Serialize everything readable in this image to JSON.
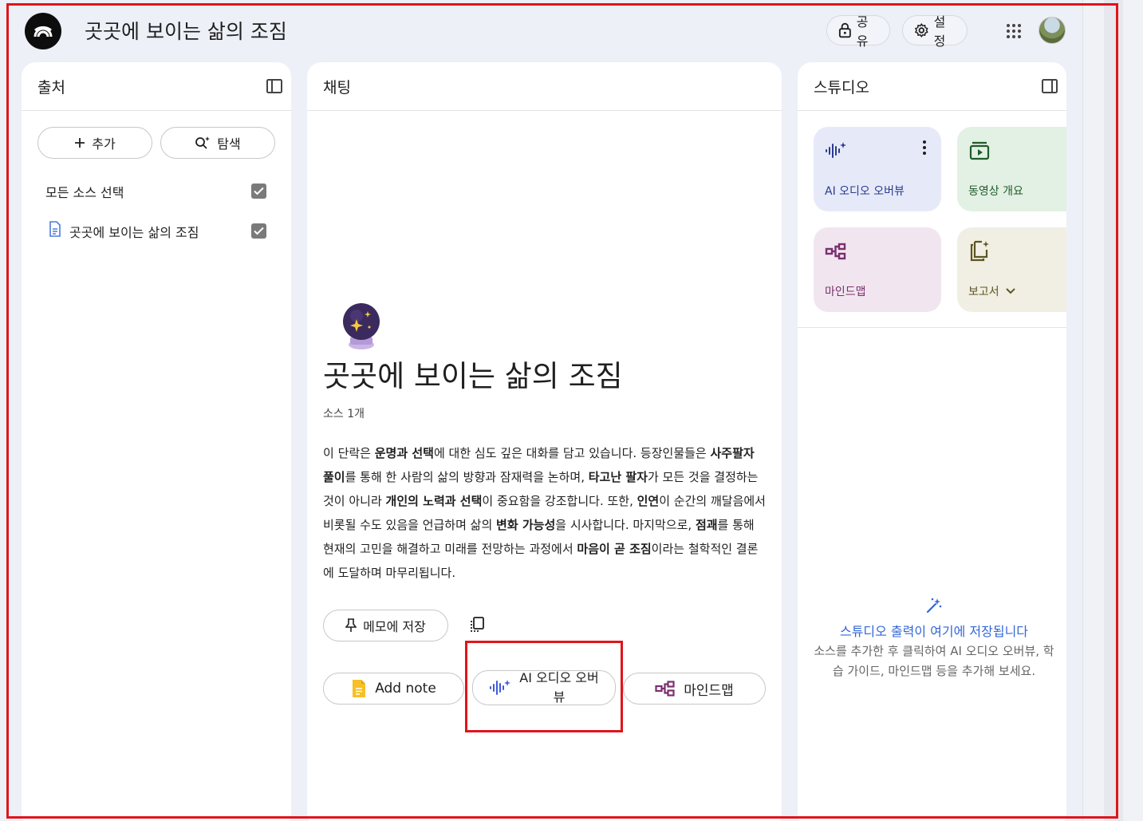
{
  "header": {
    "title": "곳곳에 보이는 삶의 조짐",
    "share_label": "공유",
    "settings_label": "설정"
  },
  "sources": {
    "title": "출처",
    "add_label": "추가",
    "explore_label": "탐색",
    "select_all_label": "모든 소스 선택",
    "items": [
      {
        "label": "곳곳에 보이는 삶의 조짐",
        "checked": true
      }
    ]
  },
  "chat": {
    "title": "채팅",
    "notebook_title": "곳곳에 보이는 삶의 조짐",
    "source_count": "소스 1개",
    "summary_parts": [
      {
        "text": "이 단락은 ",
        "bold": false
      },
      {
        "text": "운명과 선택",
        "bold": true
      },
      {
        "text": "에 대한 심도 깊은 대화를 담고 있습니다. 등장인물들은 ",
        "bold": false
      },
      {
        "text": "사주팔자 풀이",
        "bold": true
      },
      {
        "text": "를 통해 한 사람의 삶의 방향과 잠재력을 논하며, ",
        "bold": false
      },
      {
        "text": "타고난 팔자",
        "bold": true
      },
      {
        "text": "가 모든 것을 결정하는 것이 아니라 ",
        "bold": false
      },
      {
        "text": "개인의 노력과 선택",
        "bold": true
      },
      {
        "text": "이 중요함을 강조합니다. 또한, ",
        "bold": false
      },
      {
        "text": "인연",
        "bold": true
      },
      {
        "text": "이 순간의 깨달음에서 비롯될 수도 있음을 언급하며 삶의 ",
        "bold": false
      },
      {
        "text": "변화 가능성",
        "bold": true
      },
      {
        "text": "을 시사합니다. 마지막으로, ",
        "bold": false
      },
      {
        "text": "점괘",
        "bold": true
      },
      {
        "text": "를 통해 현재의 고민을 해결하고 미래를 전망하는 과정에서 ",
        "bold": false
      },
      {
        "text": "마음이 곧 조짐",
        "bold": true
      },
      {
        "text": "이라는 철학적인 결론에 도달하며 마무리됩니다.",
        "bold": false
      }
    ],
    "save_note_label": "메모에 저장",
    "suggestions": {
      "add_note": "Add note",
      "audio_overview": "AI 오디오 오버뷰",
      "mind_map": "마인드맵"
    }
  },
  "studio": {
    "title": "스튜디오",
    "cards": [
      {
        "label": "AI 오디오 오버뷰",
        "icon": "audio-wave-icon",
        "bg": "#e6eaf8",
        "fg": "#2a3b8f"
      },
      {
        "label": "동영상 개요",
        "icon": "video-icon",
        "bg": "#e3f0e4",
        "fg": "#1f5c2a"
      },
      {
        "label": "마인드맵",
        "icon": "mind-map-icon",
        "bg": "#f1e6ef",
        "fg": "#7a2f6e"
      },
      {
        "label": "보고서",
        "icon": "report-icon",
        "bg": "#f1efe3",
        "fg": "#5b5522"
      }
    ],
    "empty_title": "스튜디오 출력이 여기에 저장됩니다",
    "empty_desc": "소스를 추가한 후 클릭하여 AI 오디오 오버뷰, 학습 가이드, 마인드맵 등을 추가해 보세요."
  },
  "colors": {
    "accent": "#3367d6",
    "highlight": "#e0141b",
    "app_bg": "#eef0f8"
  }
}
